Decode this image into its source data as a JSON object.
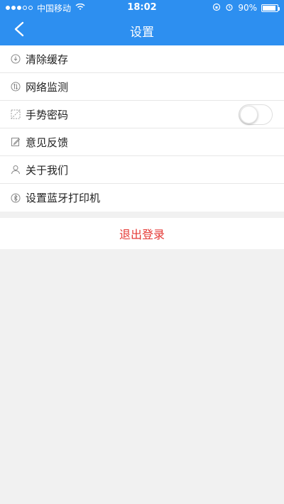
{
  "status_bar": {
    "signal_dots": [
      true,
      true,
      true,
      false,
      false
    ],
    "carrier": "中国移动",
    "time": "18:02",
    "battery_percent": "90%",
    "battery_level": 0.9
  },
  "nav": {
    "title": "设置"
  },
  "settings": {
    "items": [
      {
        "label": "清除缓存",
        "icon": "clear-cache-icon"
      },
      {
        "label": "网络监测",
        "icon": "network-check-icon"
      },
      {
        "label": "手势密码",
        "icon": "gesture-password-icon",
        "toggle_on": false
      },
      {
        "label": "意见反馈",
        "icon": "feedback-icon"
      },
      {
        "label": "关于我们",
        "icon": "about-us-icon"
      },
      {
        "label": "设置蓝牙打印机",
        "icon": "bluetooth-printer-icon"
      }
    ]
  },
  "logout": {
    "label": "退出登录"
  },
  "colors": {
    "primary": "#2d8ff0",
    "background": "#f1f1f1",
    "logout_text": "#e53935"
  }
}
